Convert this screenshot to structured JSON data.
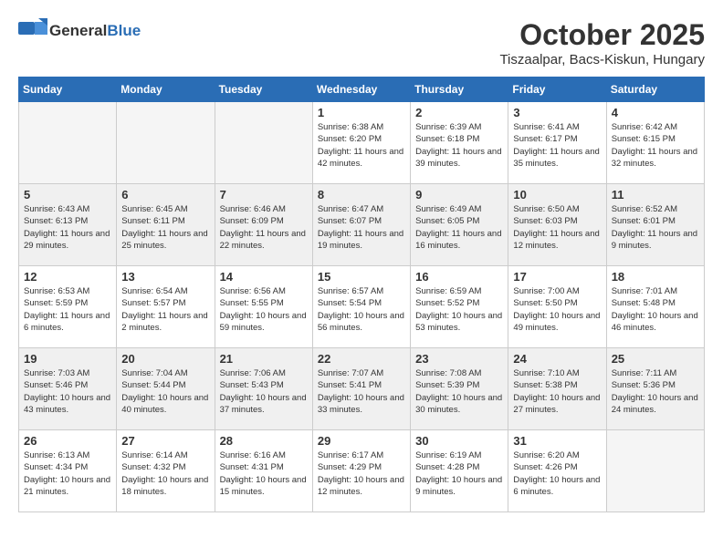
{
  "header": {
    "logo_general": "General",
    "logo_blue": "Blue",
    "month_title": "October 2025",
    "location": "Tiszaalpar, Bacs-Kiskun, Hungary"
  },
  "weekdays": [
    "Sunday",
    "Monday",
    "Tuesday",
    "Wednesday",
    "Thursday",
    "Friday",
    "Saturday"
  ],
  "weeks": [
    [
      {
        "day": "",
        "info": ""
      },
      {
        "day": "",
        "info": ""
      },
      {
        "day": "",
        "info": ""
      },
      {
        "day": "1",
        "info": "Sunrise: 6:38 AM\nSunset: 6:20 PM\nDaylight: 11 hours\nand 42 minutes."
      },
      {
        "day": "2",
        "info": "Sunrise: 6:39 AM\nSunset: 6:18 PM\nDaylight: 11 hours\nand 39 minutes."
      },
      {
        "day": "3",
        "info": "Sunrise: 6:41 AM\nSunset: 6:17 PM\nDaylight: 11 hours\nand 35 minutes."
      },
      {
        "day": "4",
        "info": "Sunrise: 6:42 AM\nSunset: 6:15 PM\nDaylight: 11 hours\nand 32 minutes."
      }
    ],
    [
      {
        "day": "5",
        "info": "Sunrise: 6:43 AM\nSunset: 6:13 PM\nDaylight: 11 hours\nand 29 minutes."
      },
      {
        "day": "6",
        "info": "Sunrise: 6:45 AM\nSunset: 6:11 PM\nDaylight: 11 hours\nand 25 minutes."
      },
      {
        "day": "7",
        "info": "Sunrise: 6:46 AM\nSunset: 6:09 PM\nDaylight: 11 hours\nand 22 minutes."
      },
      {
        "day": "8",
        "info": "Sunrise: 6:47 AM\nSunset: 6:07 PM\nDaylight: 11 hours\nand 19 minutes."
      },
      {
        "day": "9",
        "info": "Sunrise: 6:49 AM\nSunset: 6:05 PM\nDaylight: 11 hours\nand 16 minutes."
      },
      {
        "day": "10",
        "info": "Sunrise: 6:50 AM\nSunset: 6:03 PM\nDaylight: 11 hours\nand 12 minutes."
      },
      {
        "day": "11",
        "info": "Sunrise: 6:52 AM\nSunset: 6:01 PM\nDaylight: 11 hours\nand 9 minutes."
      }
    ],
    [
      {
        "day": "12",
        "info": "Sunrise: 6:53 AM\nSunset: 5:59 PM\nDaylight: 11 hours\nand 6 minutes."
      },
      {
        "day": "13",
        "info": "Sunrise: 6:54 AM\nSunset: 5:57 PM\nDaylight: 11 hours\nand 2 minutes."
      },
      {
        "day": "14",
        "info": "Sunrise: 6:56 AM\nSunset: 5:55 PM\nDaylight: 10 hours\nand 59 minutes."
      },
      {
        "day": "15",
        "info": "Sunrise: 6:57 AM\nSunset: 5:54 PM\nDaylight: 10 hours\nand 56 minutes."
      },
      {
        "day": "16",
        "info": "Sunrise: 6:59 AM\nSunset: 5:52 PM\nDaylight: 10 hours\nand 53 minutes."
      },
      {
        "day": "17",
        "info": "Sunrise: 7:00 AM\nSunset: 5:50 PM\nDaylight: 10 hours\nand 49 minutes."
      },
      {
        "day": "18",
        "info": "Sunrise: 7:01 AM\nSunset: 5:48 PM\nDaylight: 10 hours\nand 46 minutes."
      }
    ],
    [
      {
        "day": "19",
        "info": "Sunrise: 7:03 AM\nSunset: 5:46 PM\nDaylight: 10 hours\nand 43 minutes."
      },
      {
        "day": "20",
        "info": "Sunrise: 7:04 AM\nSunset: 5:44 PM\nDaylight: 10 hours\nand 40 minutes."
      },
      {
        "day": "21",
        "info": "Sunrise: 7:06 AM\nSunset: 5:43 PM\nDaylight: 10 hours\nand 37 minutes."
      },
      {
        "day": "22",
        "info": "Sunrise: 7:07 AM\nSunset: 5:41 PM\nDaylight: 10 hours\nand 33 minutes."
      },
      {
        "day": "23",
        "info": "Sunrise: 7:08 AM\nSunset: 5:39 PM\nDaylight: 10 hours\nand 30 minutes."
      },
      {
        "day": "24",
        "info": "Sunrise: 7:10 AM\nSunset: 5:38 PM\nDaylight: 10 hours\nand 27 minutes."
      },
      {
        "day": "25",
        "info": "Sunrise: 7:11 AM\nSunset: 5:36 PM\nDaylight: 10 hours\nand 24 minutes."
      }
    ],
    [
      {
        "day": "26",
        "info": "Sunrise: 6:13 AM\nSunset: 4:34 PM\nDaylight: 10 hours\nand 21 minutes."
      },
      {
        "day": "27",
        "info": "Sunrise: 6:14 AM\nSunset: 4:32 PM\nDaylight: 10 hours\nand 18 minutes."
      },
      {
        "day": "28",
        "info": "Sunrise: 6:16 AM\nSunset: 4:31 PM\nDaylight: 10 hours\nand 15 minutes."
      },
      {
        "day": "29",
        "info": "Sunrise: 6:17 AM\nSunset: 4:29 PM\nDaylight: 10 hours\nand 12 minutes."
      },
      {
        "day": "30",
        "info": "Sunrise: 6:19 AM\nSunset: 4:28 PM\nDaylight: 10 hours\nand 9 minutes."
      },
      {
        "day": "31",
        "info": "Sunrise: 6:20 AM\nSunset: 4:26 PM\nDaylight: 10 hours\nand 6 minutes."
      },
      {
        "day": "",
        "info": ""
      }
    ]
  ]
}
